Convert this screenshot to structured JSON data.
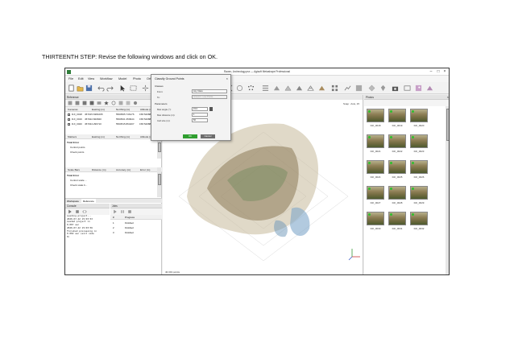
{
  "caption": "THIRTEENTH STEP: Revise the following windows and click on OK.",
  "window": {
    "title": "Raven, Archeology.psx — Agisoft Metashape Professional",
    "menu": [
      "File",
      "Edit",
      "View",
      "Workflow",
      "Model",
      "Photo",
      "Ortho",
      "Tools",
      "Help"
    ]
  },
  "reference": {
    "title": "Reference",
    "cameras_headers": [
      "Cameras",
      "Easting (m)",
      "Northing (m)",
      "Altitude (m)"
    ],
    "cameras_rows": [
      [
        "DJI_0018",
        "457015.6381095",
        "5500505.746176",
        "158.520888"
      ],
      [
        "DJI_0019",
        "457022.820840",
        "5500521.350944",
        "158.520888"
      ],
      [
        "DJI_0020",
        "457034.296710",
        "5500515.864207",
        "158.520888"
      ]
    ],
    "markers_headers": [
      "Markers",
      "Easting (m)",
      "Northing (m)",
      "Altitude (m)"
    ],
    "total_error_1": "Total Error",
    "control_points": "Control points",
    "check_points": "Check points",
    "scale_headers": [
      "Scale Bars",
      "Distance (m)",
      "Accuracy (m)",
      "Error (m)"
    ],
    "total_error_2": "Total Error",
    "control_scale": "Control scale ...",
    "check_scale": "Check scale b...",
    "bottom_tabs": [
      "Workspace",
      "Reference"
    ]
  },
  "console": {
    "title": "Console",
    "lines": [
      "Loading project...",
      "2020-07-22 15:03:53",
      "Loaded project in",
      "0.007 sec",
      "2020-07-22 15:03:56",
      "Finished processing in",
      "0.002 sec (exit code",
      "0)"
    ]
  },
  "jobs": {
    "title": "Jobs",
    "headers": [
      "#",
      "Progress"
    ],
    "rows": [
      [
        "1",
        "Finished"
      ],
      [
        "2",
        "Finished"
      ],
      [
        "3",
        "Finished"
      ]
    ]
  },
  "model": {
    "tabs": [
      "Model",
      "Ortho"
    ],
    "perspective": "Perspective 30°",
    "snap": "Snap : Axis, 15",
    "points": "40,319 points"
  },
  "dialog": {
    "title": "Classify Ground Points",
    "classes_label": "Classes",
    "from_label": "From:",
    "from_value": "Any Class",
    "to_label": "To:",
    "to_value": "Ground > Low Points",
    "params_label": "Parameters",
    "angle_label": "Max angle (°):",
    "angle_value": "15.0",
    "distance_label": "Max distance (m):",
    "distance_value": "1",
    "cell_label": "Cell size (m):",
    "cell_value": "50",
    "ok": "OK",
    "cancel": "Cancel"
  },
  "photos": {
    "title": "Photos",
    "labels": [
      "DJI_0018",
      "DJI_0019",
      "DJI_0020",
      "DJI_0021",
      "DJI_0022",
      "DJI_0023",
      "DJI_0024",
      "DJI_0025",
      "DJI_0026",
      "DJI_0027",
      "DJI_0028",
      "DJI_0029",
      "DJI_0030",
      "DJI_0031",
      "DJI_0032"
    ]
  }
}
